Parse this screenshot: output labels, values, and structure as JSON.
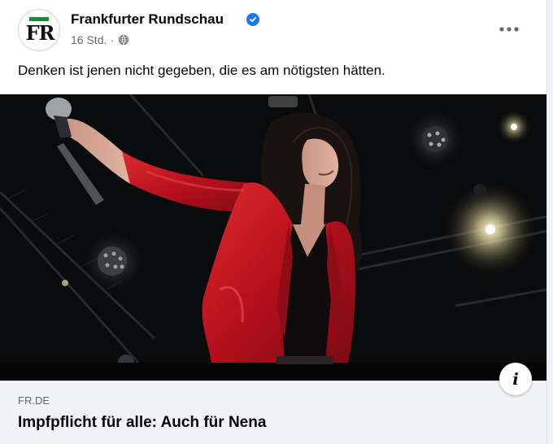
{
  "post": {
    "page_name": "Frankfurter Rundschau",
    "avatar_text": "FR",
    "timestamp": "16 Std.",
    "separator": "·",
    "privacy_icon": "globe-icon",
    "more_icon": "more-horizontal-icon",
    "verified_icon": "verified-badge-icon",
    "text": "Denken ist jenen nicht gegeben, die es am nötigsten hätten."
  },
  "link": {
    "domain": "FR.DE",
    "headline": "Impfpflicht für alle: Auch für Nena",
    "info_label": "i",
    "image_alt": "Sängerin in roter Jacke mit Mikrofon auf der Bühne"
  },
  "colors": {
    "accent": "#1877f2",
    "logo_green": "#1a8a3a",
    "jacket_red": "#c8121c"
  }
}
